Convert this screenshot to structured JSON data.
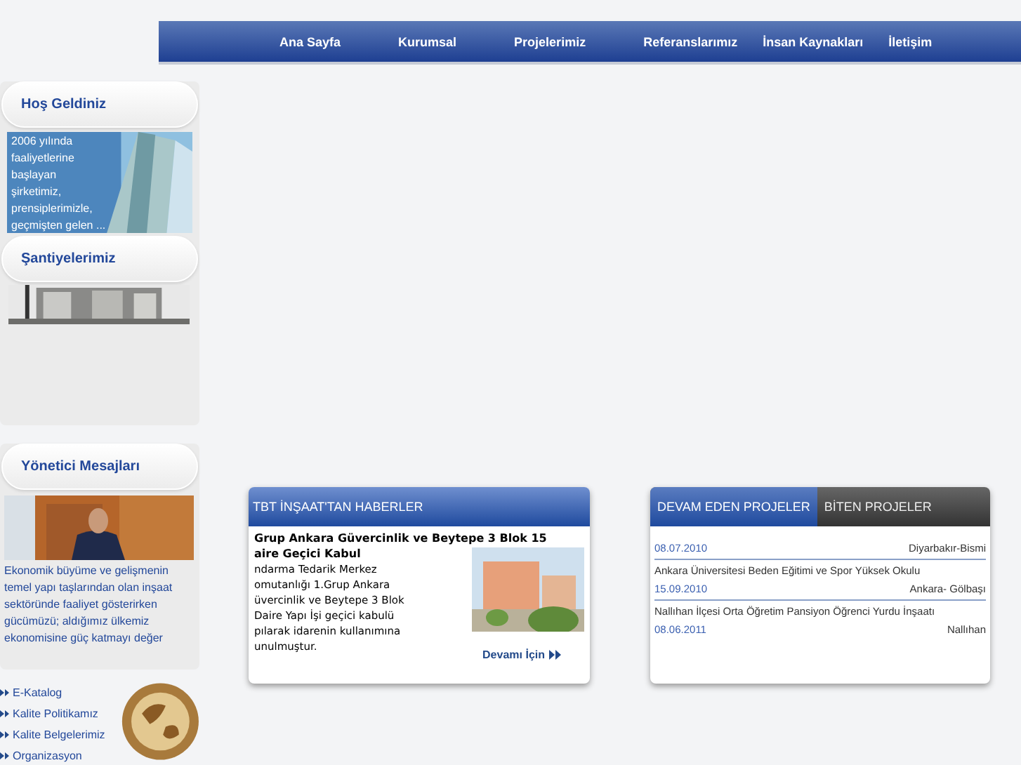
{
  "nav": [
    {
      "label": "Ana Sayfa"
    },
    {
      "label": "Kurumsal"
    },
    {
      "label": "Projelerimiz"
    },
    {
      "label": "Referanslarımız"
    },
    {
      "label": "İnsan Kaynakları"
    },
    {
      "label": "İletişim"
    }
  ],
  "sidebar": {
    "welcome": {
      "title": "Hoş Geldiniz",
      "lines": [
        "2006 yılında",
        "faaliyetlerine",
        "başlayan",
        "şirketimiz,",
        "prensiplerimizle,",
        "geçmişten gelen ..."
      ]
    },
    "sites": {
      "title": "Şantiyelerimiz"
    },
    "manager": {
      "title": "Yönetici Mesajları",
      "lines": [
        "Ekonomik büyüme ve gelişmenin",
        "temel yapı taşlarından olan inşaat",
        "sektöründe faaliyet gösterirken",
        "gücümüzü; aldığımız ülkemiz",
        "ekonomisine güç katmayı değer"
      ]
    },
    "links": [
      "E-Katalog",
      "Kalite Politikamız",
      "Kalite Belgelerimiz",
      "Organizasyon"
    ]
  },
  "news": {
    "title": "TBT İNŞAAT'TAN HABERLER",
    "headline": [
      "Grup Ankara Güvercinlik ve Beytepe 3 Blok 15",
      "aire Geçici Kabul"
    ],
    "body": [
      "ndarma Tedarik Merkez",
      "omutanlığı 1.Grup Ankara",
      "üvercinlik ve Beytepe 3 Blok",
      "Daire Yapı İşi geçici kabulü",
      "pılarak idarenin kullanımına",
      "unulmuştur."
    ],
    "more": "Devamı İçin"
  },
  "projects": {
    "tabs": [
      {
        "label": "DEVAM EDEN PROJELER",
        "selected": true
      },
      {
        "label": "BİTEN PROJELER",
        "selected": false
      }
    ],
    "items": [
      {
        "date": "08.07.2010",
        "place": "Diyarbakır-Bismi"
      },
      {
        "name": "Ankara Üniversitesi Beden Eğitimi ve Spor Yüksek Okulu",
        "date": "15.09.2010",
        "place": "Ankara- Gölbaşı"
      },
      {
        "name": "Nallıhan İlçesi Orta Öğretim Pansiyon Öğrenci Yurdu İnşaatı",
        "date": "08.06.2011",
        "place": "Nallıhan"
      }
    ]
  }
}
